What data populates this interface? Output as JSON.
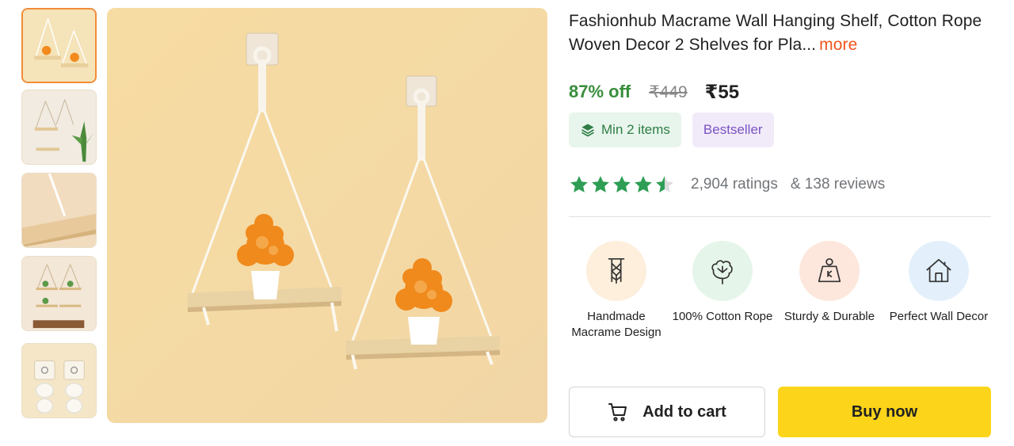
{
  "product": {
    "title": "Fashionhub Macrame Wall Hanging Shelf, Cotton Rope Woven Decor 2 Shelves for Pla...",
    "more_label": "more"
  },
  "pricing": {
    "discount": "87% off",
    "mrp": "₹449",
    "price": "₹55"
  },
  "badges": {
    "min_items": "Min 2 items",
    "bestseller": "Bestseller"
  },
  "rating": {
    "stars": 4.5,
    "ratings_text": "2,904 ratings",
    "reviews_text": "& 138 reviews",
    "star_color": "#2e9e55"
  },
  "features": [
    {
      "icon": "macrame-icon",
      "label": "Handmade Macrame Design",
      "bg": "#fdefdc"
    },
    {
      "icon": "cotton-icon",
      "label": "100% Cotton Rope",
      "bg": "#e6f5e9"
    },
    {
      "icon": "weight-icon",
      "label": "Sturdy & Durable",
      "bg": "#fde7dc"
    },
    {
      "icon": "home-icon",
      "label": "Perfect Wall Decor",
      "bg": "#e3f0fb"
    }
  ],
  "actions": {
    "add_to_cart": "Add to cart",
    "buy_now": "Buy now"
  },
  "gallery": {
    "thumbnail_count": 5,
    "active_index": 0
  }
}
